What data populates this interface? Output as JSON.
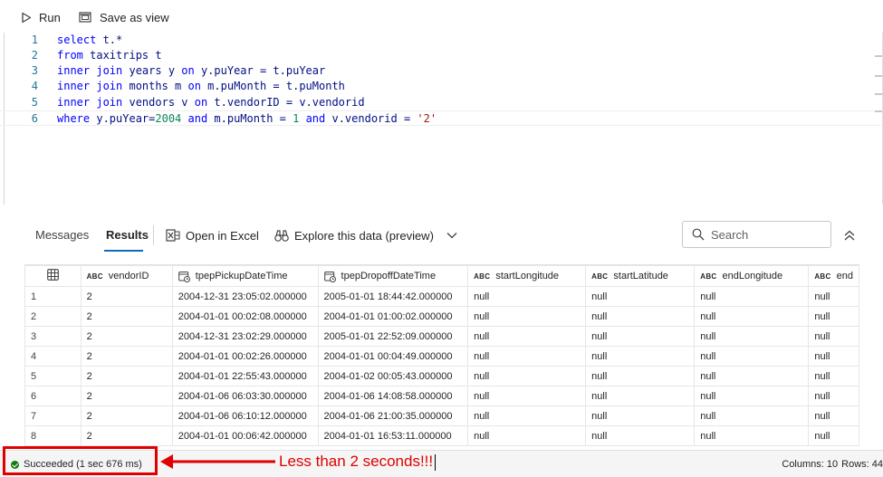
{
  "toolbar": {
    "run_label": "Run",
    "save_label": "Save as view"
  },
  "editor": {
    "lines": [
      {
        "num": "1",
        "tokens": [
          [
            "kw",
            "select"
          ],
          [
            "id",
            " t.*"
          ]
        ]
      },
      {
        "num": "2",
        "tokens": [
          [
            "kw",
            "from"
          ],
          [
            "id",
            " taxitrips t"
          ]
        ]
      },
      {
        "num": "3",
        "tokens": [
          [
            "kw",
            "inner join"
          ],
          [
            "id",
            " years y "
          ],
          [
            "kw",
            "on"
          ],
          [
            "id",
            " y.puYear = t.puYear"
          ]
        ]
      },
      {
        "num": "4",
        "tokens": [
          [
            "kw",
            "inner join"
          ],
          [
            "id",
            " months m "
          ],
          [
            "kw",
            "on"
          ],
          [
            "id",
            " m.puMonth = t.puMonth"
          ]
        ]
      },
      {
        "num": "5",
        "tokens": [
          [
            "kw",
            "inner join"
          ],
          [
            "id",
            " vendors v "
          ],
          [
            "kw",
            "on"
          ],
          [
            "id",
            " t.vendorID = v.vendorid"
          ]
        ]
      },
      {
        "num": "6",
        "tokens": [
          [
            "kw",
            "where"
          ],
          [
            "id",
            " y.puYear="
          ],
          [
            "num",
            "2004"
          ],
          [
            "kw",
            " and"
          ],
          [
            "id",
            " m.puMonth = "
          ],
          [
            "num",
            "1"
          ],
          [
            "kw",
            " and"
          ],
          [
            "id",
            " v.vendorid = "
          ],
          [
            "str",
            "'2'"
          ]
        ]
      }
    ]
  },
  "results": {
    "tabs": {
      "messages": "Messages",
      "results": "Results"
    },
    "open_excel": "Open in Excel",
    "explore": "Explore this data (preview)",
    "search_placeholder": "Search"
  },
  "grid": {
    "columns": [
      {
        "name": "vendorID",
        "type": "ABC"
      },
      {
        "name": "tpepPickupDateTime",
        "type": "datetime"
      },
      {
        "name": "tpepDropoffDateTime",
        "type": "datetime"
      },
      {
        "name": "startLongitude",
        "type": "ABC"
      },
      {
        "name": "startLatitude",
        "type": "ABC"
      },
      {
        "name": "endLongitude",
        "type": "ABC"
      },
      {
        "name": "end",
        "type": "ABC"
      }
    ],
    "rows": [
      [
        "1",
        "2",
        "2004-12-31 23:05:02.000000",
        "2005-01-01 18:44:42.000000",
        "null",
        "null",
        "null",
        "null"
      ],
      [
        "2",
        "2",
        "2004-01-01 00:02:08.000000",
        "2004-01-01 01:00:02.000000",
        "null",
        "null",
        "null",
        "null"
      ],
      [
        "3",
        "2",
        "2004-12-31 23:02:29.000000",
        "2005-01-01 22:52:09.000000",
        "null",
        "null",
        "null",
        "null"
      ],
      [
        "4",
        "2",
        "2004-01-01 00:02:26.000000",
        "2004-01-01 00:04:49.000000",
        "null",
        "null",
        "null",
        "null"
      ],
      [
        "5",
        "2",
        "2004-01-01 22:55:43.000000",
        "2004-01-02 00:05:43.000000",
        "null",
        "null",
        "null",
        "null"
      ],
      [
        "6",
        "2",
        "2004-01-06 06:03:30.000000",
        "2004-01-06 14:08:58.000000",
        "null",
        "null",
        "null",
        "null"
      ],
      [
        "7",
        "2",
        "2004-01-06 06:10:12.000000",
        "2004-01-06 21:00:35.000000",
        "null",
        "null",
        "null",
        "null"
      ],
      [
        "8",
        "2",
        "2004-01-01 00:06:42.000000",
        "2004-01-01 16:53:11.000000",
        "null",
        "null",
        "null",
        "null"
      ]
    ]
  },
  "status": {
    "message": "Succeeded (1 sec 676 ms)",
    "columns": "Columns: 10",
    "rows": "Rows: 44",
    "annotation": "Less than 2 seconds!!!"
  },
  "colors": {
    "accent": "#0f6cbd",
    "success": "#107c10",
    "annotation": "#e00000"
  }
}
